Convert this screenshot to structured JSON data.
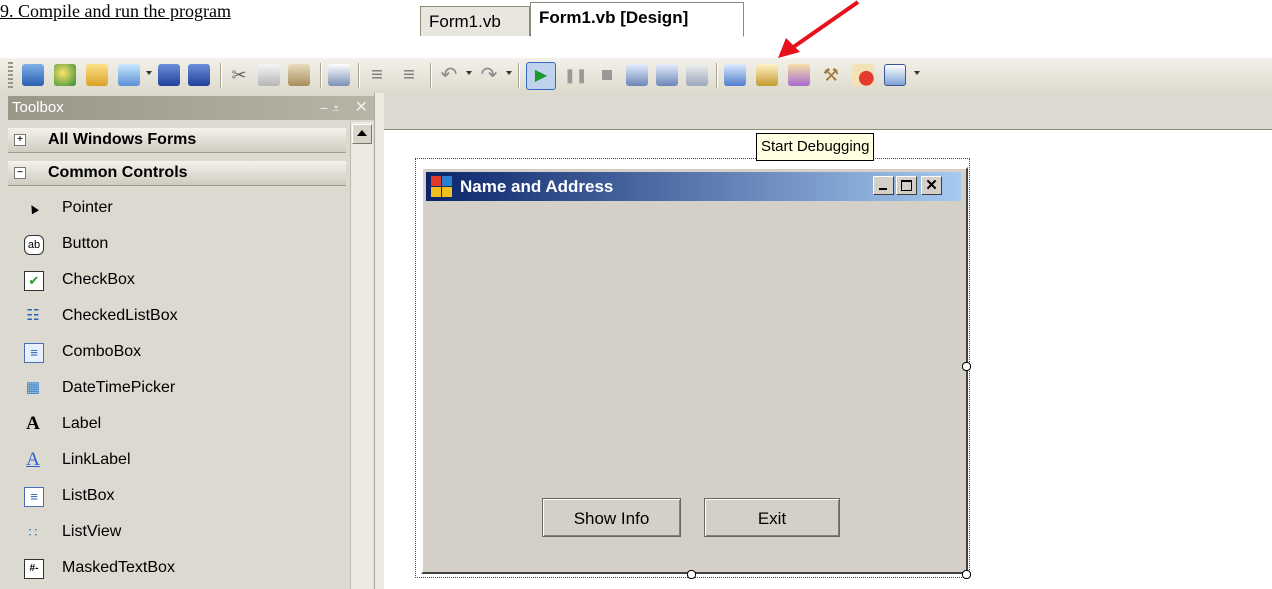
{
  "heading": "9. Compile and run the program",
  "toolbar": {
    "icons": [
      "new-project-icon",
      "add-new-item-icon",
      "open-file-icon",
      "add-item-icon",
      "save-icon",
      "save-all-icon",
      "cut-icon",
      "copy-icon",
      "paste-icon",
      "find-icon",
      "comment-icon",
      "uncomment-icon",
      "undo-icon",
      "redo-icon",
      "start-debugging-icon",
      "pause-icon",
      "stop-icon",
      "step-into-icon",
      "step-over-icon",
      "step-out-icon",
      "solution-explorer-icon",
      "properties-icon",
      "object-browser-icon",
      "toolbox-icon",
      "error-list-icon",
      "command-window-icon"
    ]
  },
  "tooltip": "Start Debugging",
  "toolbox": {
    "title": "Toolbox",
    "pin": "− ⩡",
    "close": "✕",
    "categories": [
      {
        "label": "All Windows Forms",
        "state": "+"
      },
      {
        "label": "Common Controls",
        "state": "−"
      }
    ],
    "items": [
      {
        "label": "Pointer",
        "icon": "pointer-icon",
        "glyph": "▲"
      },
      {
        "label": "Button",
        "icon": "button-icon",
        "glyph": "ab"
      },
      {
        "label": "CheckBox",
        "icon": "checkbox-icon",
        "glyph": "✔"
      },
      {
        "label": "CheckedListBox",
        "icon": "checked-listbox-icon",
        "glyph": "☷"
      },
      {
        "label": "ComboBox",
        "icon": "combobox-icon",
        "glyph": "≡"
      },
      {
        "label": "DateTimePicker",
        "icon": "datetimepicker-icon",
        "glyph": "▦"
      },
      {
        "label": "Label",
        "icon": "label-icon",
        "glyph": "A"
      },
      {
        "label": "LinkLabel",
        "icon": "linklabel-icon",
        "glyph": "A"
      },
      {
        "label": "ListBox",
        "icon": "listbox-icon",
        "glyph": "≡"
      },
      {
        "label": "ListView",
        "icon": "listview-icon",
        "glyph": "∷"
      },
      {
        "label": "MaskedTextBox",
        "icon": "maskedtextbox-icon",
        "glyph": "#-"
      }
    ]
  },
  "tabs": [
    {
      "label": "Form1.vb"
    },
    {
      "label": "Form1.vb [Design]"
    }
  ],
  "form": {
    "title": "Name and Address",
    "buttons": [
      {
        "label": "Show Info"
      },
      {
        "label": "Exit"
      }
    ]
  }
}
